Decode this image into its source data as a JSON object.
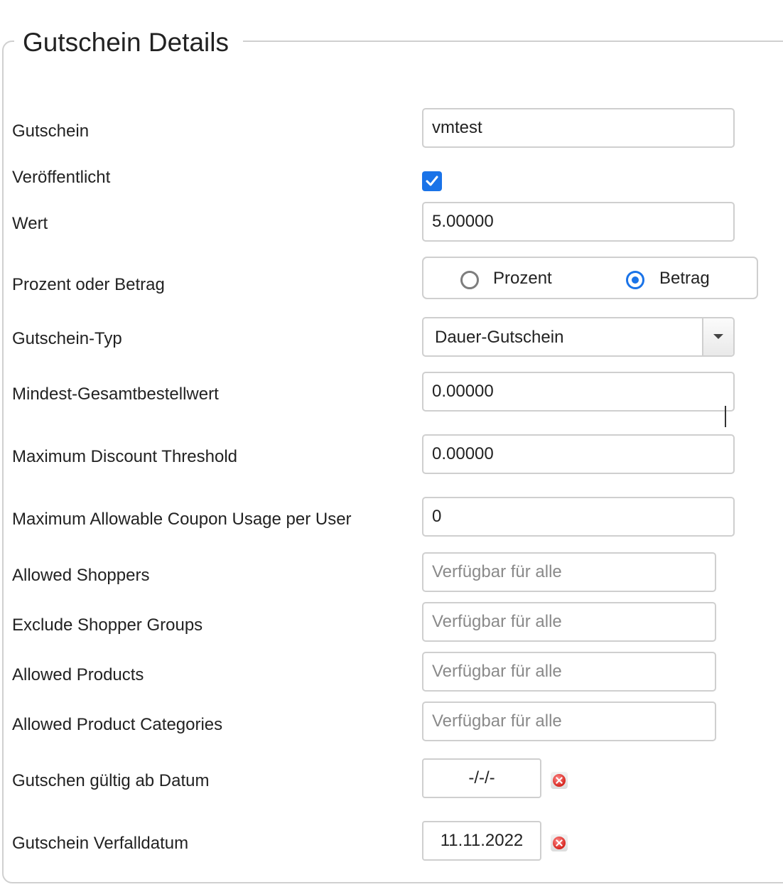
{
  "legend": "Gutschein Details",
  "fields": {
    "gutschein": {
      "label": "Gutschein",
      "value": "vmtest"
    },
    "veroeffentlicht": {
      "label": "Veröffentlicht",
      "checked": true
    },
    "wert": {
      "label": "Wert",
      "value": "5.00000"
    },
    "prozent_betrag": {
      "label": "Prozent oder Betrag",
      "option1": "Prozent",
      "option2": "Betrag",
      "selected": "Betrag"
    },
    "typ": {
      "label": "Gutschein-Typ",
      "value": "Dauer-Gutschein"
    },
    "mindest": {
      "label": "Mindest-Gesamtbestellwert",
      "value": "0.00000"
    },
    "max_discount": {
      "label": "Maximum Discount Threshold",
      "value": "0.00000"
    },
    "max_usage": {
      "label": "Maximum Allowable Coupon Usage per User",
      "value": "0"
    },
    "allowed_shoppers": {
      "label": "Allowed Shoppers",
      "placeholder": "Verfügbar für alle"
    },
    "exclude_groups": {
      "label": "Exclude Shopper Groups",
      "placeholder": "Verfügbar für alle"
    },
    "allowed_products": {
      "label": "Allowed Products",
      "placeholder": "Verfügbar für alle"
    },
    "allowed_categories": {
      "label": "Allowed Product Categories",
      "placeholder": "Verfügbar für alle"
    },
    "gueltig_ab": {
      "label": "Gutschen gültig ab Datum",
      "value": "-/-/-"
    },
    "verfall": {
      "label": "Gutschein Verfalldatum",
      "value": "11.11.2022"
    }
  }
}
